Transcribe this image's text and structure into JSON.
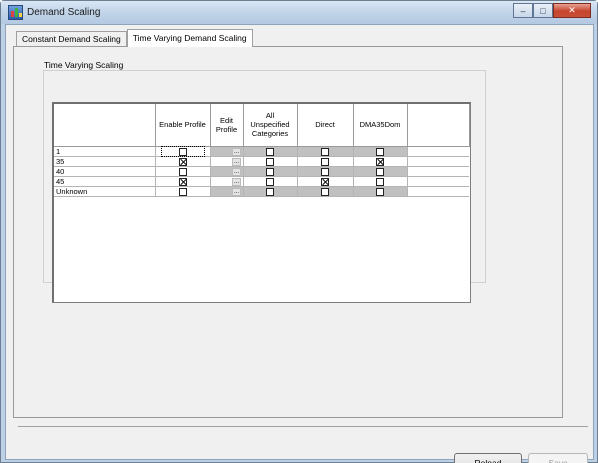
{
  "window": {
    "title": "Demand Scaling",
    "controls": [
      "minimize-icon",
      "maximize-icon",
      "close-icon"
    ]
  },
  "tabs": [
    {
      "label": "Constant Demand Scaling",
      "active": false
    },
    {
      "label": "Time Varying Demand Scaling",
      "active": true
    }
  ],
  "group": {
    "title": "Time Varying Scaling"
  },
  "table": {
    "headers": [
      "",
      "Enable Profile",
      "Edit\nProfile",
      "All\nUnspecified\nCategories",
      "Direct",
      "DMA35Dom"
    ],
    "rows": [
      {
        "name": "1",
        "enable": false,
        "all_unspecified": false,
        "direct": false,
        "dma35dom": false
      },
      {
        "name": "35",
        "enable": true,
        "all_unspecified": false,
        "direct": false,
        "dma35dom": true
      },
      {
        "name": "40",
        "enable": false,
        "all_unspecified": false,
        "direct": false,
        "dma35dom": false
      },
      {
        "name": "45",
        "enable": true,
        "all_unspecified": false,
        "direct": true,
        "dma35dom": false
      },
      {
        "name": "Unknown",
        "enable": false,
        "all_unspecified": false,
        "direct": false,
        "dma35dom": false
      }
    ],
    "edit_button_label": "..."
  },
  "buttons": {
    "reload": "Reload",
    "save": "Save",
    "save_enabled": false
  }
}
